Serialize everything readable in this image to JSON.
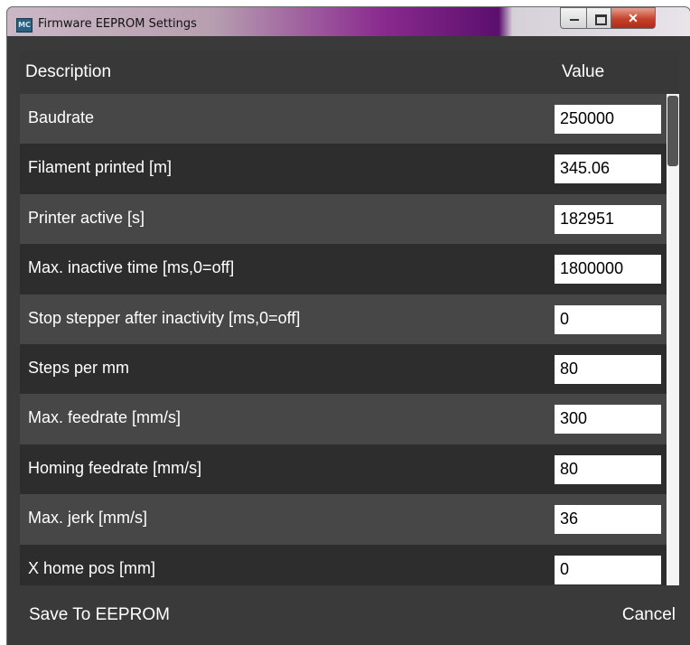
{
  "window": {
    "title": "Firmware EEPROM Settings",
    "icon_text": "MC",
    "controls": {
      "minimize": "minimize-icon",
      "maximize": "maximize-icon",
      "close": "close-icon"
    }
  },
  "table": {
    "headers": {
      "description": "Description",
      "value": "Value"
    },
    "rows": [
      {
        "description": "Baudrate",
        "value": "250000"
      },
      {
        "description": "Filament printed [m]",
        "value": "345.06"
      },
      {
        "description": "Printer active [s]",
        "value": "182951"
      },
      {
        "description": "Max. inactive time [ms,0=off]",
        "value": "1800000"
      },
      {
        "description": "Stop stepper after inactivity [ms,0=off]",
        "value": "0"
      },
      {
        "description": "Steps per mm",
        "value": "80"
      },
      {
        "description": "Max. feedrate [mm/s]",
        "value": "300"
      },
      {
        "description": "Homing feedrate [mm/s]",
        "value": "80"
      },
      {
        "description": "Max. jerk [mm/s]",
        "value": "36"
      },
      {
        "description": "X home pos [mm]",
        "value": "0"
      }
    ]
  },
  "footer": {
    "save_label": "Save To EEPROM",
    "cancel_label": "Cancel"
  },
  "colors": {
    "row_light": "#474747",
    "row_dark": "#2d2d2d",
    "background": "#3a3a3a",
    "text": "#ffffff"
  }
}
